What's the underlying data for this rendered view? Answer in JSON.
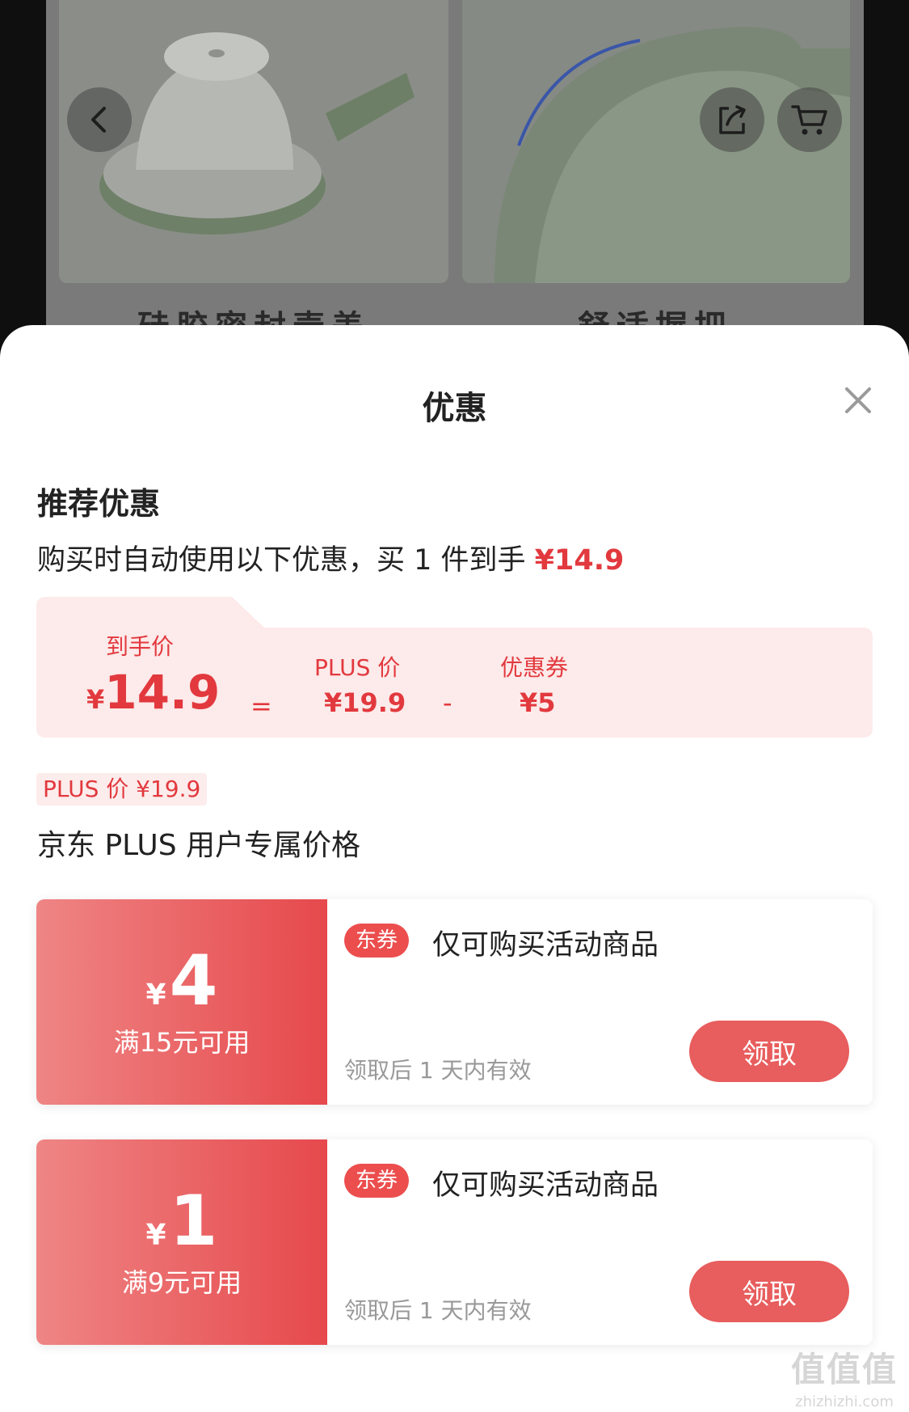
{
  "background": {
    "captions": [
      "硅胶密封壶盖",
      "舒适握把"
    ]
  },
  "sheet": {
    "title": "优惠",
    "recommend": {
      "title": "推荐优惠",
      "desc_prefix": "购买时自动使用以下优惠，买 1 件到手 ",
      "desc_price": "¥14.9"
    },
    "calc": {
      "final_label": "到手价",
      "final_yen": "¥",
      "final_value": "14.9",
      "equals": "=",
      "plus_label": "PLUS 价",
      "plus_value": "¥19.9",
      "minus": "-",
      "coupon_label": "优惠券",
      "coupon_value": "¥5"
    },
    "plus": {
      "tag": "PLUS 价 ¥19.9",
      "desc": "京东 PLUS 用户专属价格"
    },
    "coupons": [
      {
        "yen": "¥",
        "amount": "4",
        "condition": "满15元可用",
        "tag": "东券",
        "title": "仅可购买活动商品",
        "validity": "领取后 1 天内有效",
        "button": "领取"
      },
      {
        "yen": "¥",
        "amount": "1",
        "condition": "满9元可用",
        "tag": "东券",
        "title": "仅可购买活动商品",
        "validity": "领取后 1 天内有效",
        "button": "领取"
      }
    ]
  },
  "watermark": {
    "logo": "值值值",
    "url": "zhizhizhi.com"
  },
  "colors": {
    "accent": "#e2393e",
    "coupon_gradient_start": "#ef8585",
    "coupon_gradient_end": "#e6494c",
    "calc_bg": "#fdeaea"
  },
  "icons": [
    "back-icon",
    "share-icon",
    "cart-icon",
    "close-icon"
  ]
}
